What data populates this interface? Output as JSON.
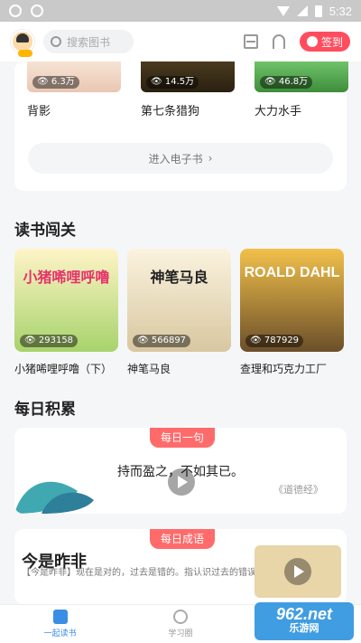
{
  "status_bar": {
    "time": "5:32"
  },
  "header": {
    "search_placeholder": "搜索图书",
    "signin_label": "签到",
    "icons": [
      "scan-icon",
      "bell-icon"
    ]
  },
  "top_books": {
    "items": [
      {
        "title": "背影",
        "views": "6.3万"
      },
      {
        "title": "第七条猎狗",
        "views": "14.5万"
      },
      {
        "title": "大力水手",
        "views": "46.8万"
      }
    ],
    "ebook_button": "进入电子书"
  },
  "reading_challenge": {
    "section_title": "读书闯关",
    "items": [
      {
        "title": "小猪唏哩呼噜（下）",
        "views": "293158",
        "cover_text": "小猪唏哩呼噜"
      },
      {
        "title": "神笔马良",
        "views": "566897",
        "cover_text": "神笔马良"
      },
      {
        "title": "查理和巧克力工厂",
        "views": "787929",
        "cover_text": "ROALD DAHL"
      }
    ]
  },
  "daily": {
    "section_title": "每日积累",
    "quote": {
      "pill": "每日一句",
      "text": "持而盈之，不如其已。",
      "source": "《道德经》"
    },
    "idiom": {
      "pill": "每日成语",
      "title": "今是昨非",
      "desc": "【今是昨非】现在是对的，过去是错的。指认识过去的错误。"
    }
  },
  "bottom_nav": {
    "items": [
      {
        "label": "一起读书",
        "active": true
      },
      {
        "label": "学习圈",
        "active": false
      }
    ]
  },
  "watermark": {
    "big": "962.net",
    "small": "乐游网"
  },
  "colors": {
    "accent": "#3a8ee6",
    "signin": "#ff4d5e",
    "pill": "#ff6b6b"
  }
}
